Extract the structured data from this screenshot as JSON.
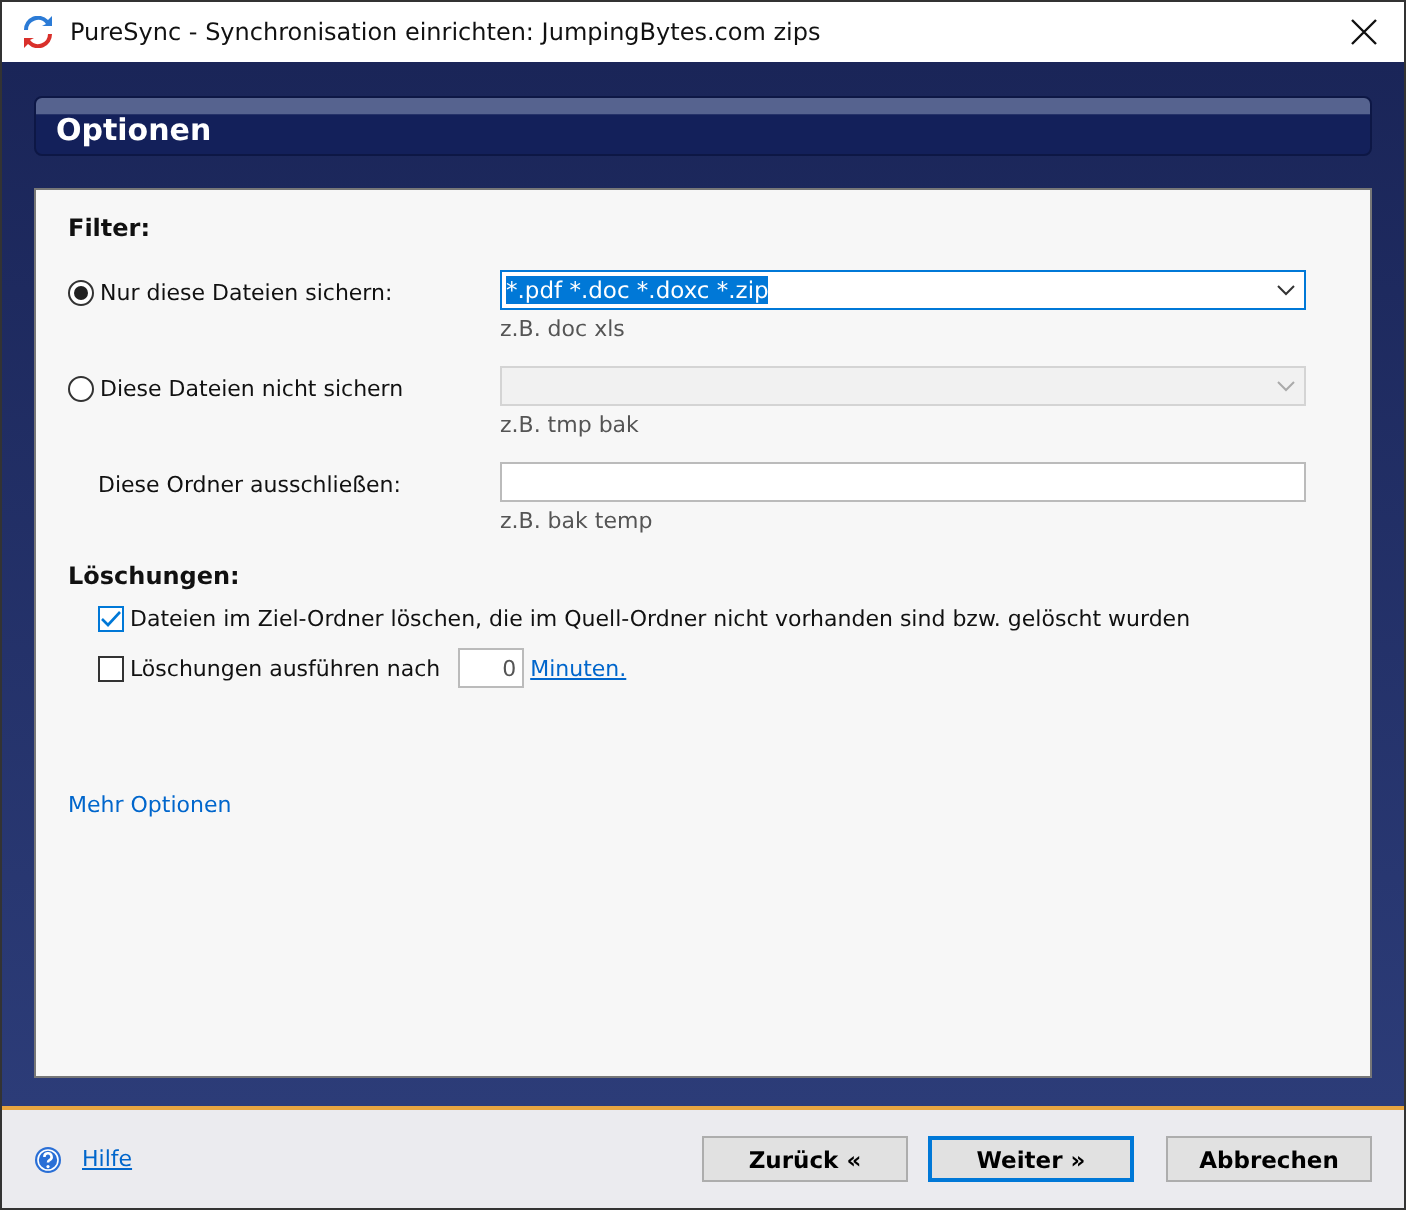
{
  "window": {
    "title": "PureSync - Synchronisation einrichten: JumpingBytes.com zips"
  },
  "header": {
    "title": "Optionen"
  },
  "filter": {
    "heading": "Filter:",
    "rows": [
      {
        "kind": "radio",
        "label": "Nur diese Dateien sichern:",
        "selected": true,
        "field": {
          "kind": "dropdown",
          "value": "*.pdf *.doc *.doxc *.zip",
          "disabled": false
        },
        "hint": "z.B. doc xls"
      },
      {
        "kind": "radio",
        "label": "Diese Dateien nicht sichern",
        "selected": false,
        "field": {
          "kind": "dropdown",
          "disabled": true
        },
        "hint": "z.B. tmp bak"
      },
      {
        "kind": "plain",
        "label": "Diese Ordner ausschließen:",
        "field": {
          "kind": "text",
          "disabled": false
        },
        "hint": "z.B. bak temp"
      }
    ]
  },
  "deletions": {
    "heading": "Löschungen:",
    "delete_missing": {
      "label": "Dateien im Ziel-Ordner löschen, die im Quell-Ordner nicht vorhanden sind bzw. gelöscht wurden",
      "checked": true
    },
    "delay": {
      "label": "Löschungen ausführen nach",
      "checked": false,
      "value": "0",
      "unit_link": "Minuten."
    }
  },
  "more_link": "Mehr Optionen",
  "footer": {
    "help": "Hilfe",
    "buttons": [
      {
        "label": "Zurück «",
        "default": false
      },
      {
        "label": "Weiter »",
        "default": true
      },
      {
        "label": "Abbrechen",
        "default": false
      }
    ]
  }
}
